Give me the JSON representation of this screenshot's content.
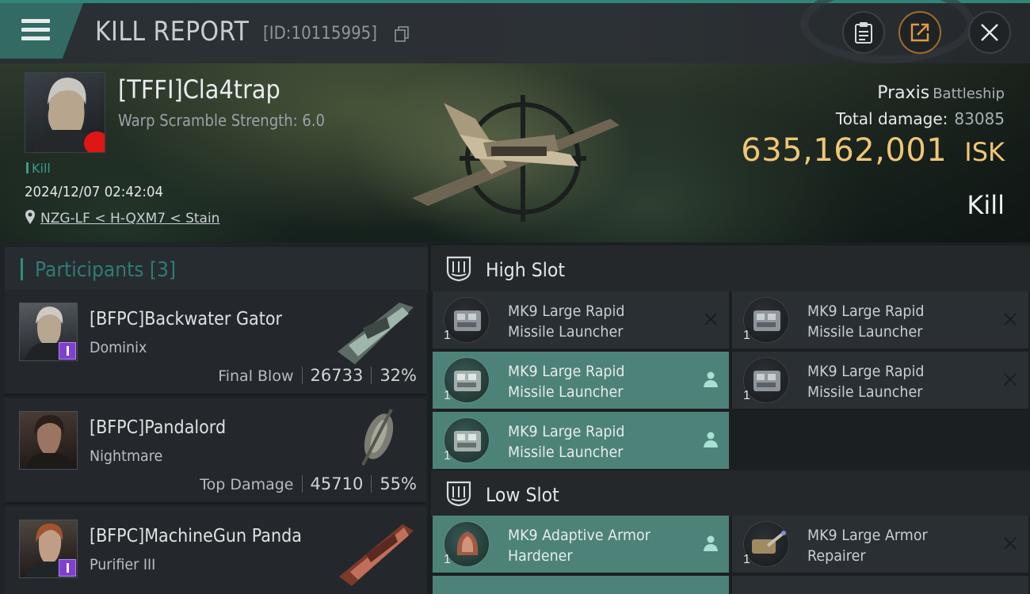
{
  "header": {
    "title": "KILL REPORT",
    "report_id": "[ID:10115995]"
  },
  "victim": {
    "name": "[TFFI]Cla4trap",
    "detail": "Warp Scramble Strength: 6.0",
    "tag": "Kill",
    "datetime": "2024/12/07 02:42:04",
    "location": "NZG-LF < H-QXM7 < Stain",
    "ship": "Praxis",
    "ship_class": "Battleship",
    "total_damage_label": "Total damage:",
    "total_damage": "83085",
    "isk_value": "635,162,001",
    "isk_unit": "ISK",
    "result": "Kill"
  },
  "participants": {
    "title": "Participants [3]",
    "rows": [
      {
        "name": "[BFPC]Backwater Gator",
        "ship": "Dominix",
        "role": "Final Blow",
        "damage": "26733",
        "percent": "32%",
        "badge": true
      },
      {
        "name": "[BFPC]Pandalord",
        "ship": "Nightmare",
        "role": "Top Damage",
        "damage": "45710",
        "percent": "55%",
        "badge": false
      },
      {
        "name": "[BFPC]MachineGun Panda",
        "ship": "Purifier III",
        "role": "",
        "damage": "",
        "percent": "",
        "badge": true
      }
    ]
  },
  "fitting": {
    "high_slot": {
      "title": "High Slot",
      "modules": [
        {
          "line1": "MK9 Large Rapid",
          "line2": "Missile Launcher",
          "qty": "1",
          "state": "destroyed"
        },
        {
          "line1": "MK9 Large Rapid",
          "line2": "Missile Launcher",
          "qty": "1",
          "state": "destroyed"
        },
        {
          "line1": "MK9 Large Rapid",
          "line2": "Missile Launcher",
          "qty": "1",
          "state": "dropped"
        },
        {
          "line1": "MK9 Large Rapid",
          "line2": "Missile Launcher",
          "qty": "1",
          "state": "destroyed"
        },
        {
          "line1": "MK9 Large Rapid",
          "line2": "Missile Launcher",
          "qty": "1",
          "state": "dropped"
        }
      ]
    },
    "low_slot": {
      "title": "Low Slot",
      "modules": [
        {
          "line1": "MK9 Adaptive Armor",
          "line2": "Hardener",
          "qty": "1",
          "state": "dropped"
        },
        {
          "line1": "MK9 Large Armor",
          "line2": "Repairer",
          "qty": "1",
          "state": "destroyed"
        }
      ]
    }
  },
  "colors": {
    "accent_teal": "#2f8578",
    "isk_gold": "#f0c675",
    "dropped_module": "#4d8279",
    "badge_purple": "#7f3fd0"
  },
  "icons": [
    "menu-icon",
    "copy-icon",
    "clipboard-icon",
    "share-icon",
    "close-icon",
    "location-pin-icon",
    "high-slot-icon",
    "low-slot-icon",
    "person-icon",
    "destroyed-x-icon"
  ]
}
